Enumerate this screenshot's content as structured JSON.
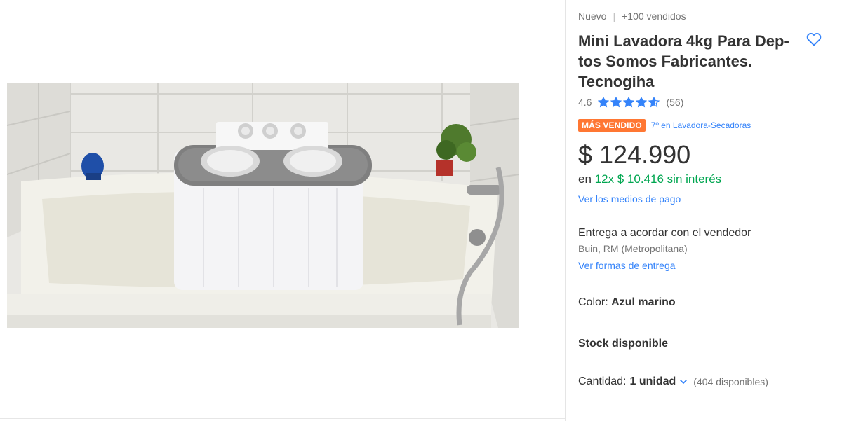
{
  "product": {
    "condition": "Nuevo",
    "separator": "|",
    "sold": "+100 vendidos",
    "title": "Mini Lavadora 4kg Para Dep­tos Somos Fabricantes. Tecnogiha",
    "favorite_icon": "heart-outline-icon",
    "image_alt": "mini lavadora en bañera"
  },
  "rating": {
    "score": "4.6",
    "stars_value": 4.6,
    "stars_max": 5,
    "count": "(56)",
    "star_color": "#3483fa"
  },
  "badge": {
    "label": "MÁS VENDIDO",
    "rank": "7º en Lavadora-Secadoras",
    "color": "#ff7733"
  },
  "price": {
    "currency": "$",
    "amount": "124.990",
    "installments_prefix": "en",
    "installments_highlight": "12x $ 10.416 sin interés",
    "payment_link": "Ver los medios de pago"
  },
  "shipping": {
    "delivery": "Entrega a acordar con el vendedor",
    "location": "Buin, RM (Metropolitana)",
    "link": "Ver formas de entrega"
  },
  "variant": {
    "label": "Color:",
    "value": "Azul marino"
  },
  "stock": {
    "label": "Stock disponible"
  },
  "quantity": {
    "label": "Cantidad:",
    "value": "1 unidad",
    "available": "(404 disponibles)"
  },
  "colors": {
    "accent": "#3483fa",
    "green": "#00a650",
    "text": "#333333",
    "muted": "#737373"
  }
}
